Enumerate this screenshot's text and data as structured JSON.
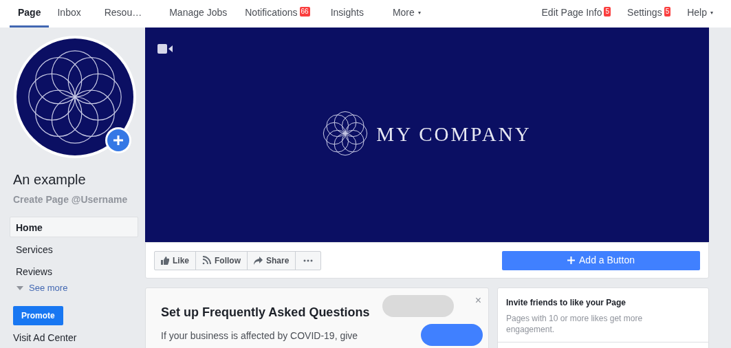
{
  "nav": {
    "tabs": [
      {
        "label": "Page",
        "selected": true
      },
      {
        "label": "Inbox",
        "selected": false
      },
      {
        "label": "Resou…",
        "selected": false
      },
      {
        "label": "Manage Jobs",
        "selected": false
      },
      {
        "label": "Notifications",
        "badge": "66",
        "selected": false
      },
      {
        "label": "Insights",
        "selected": false
      },
      {
        "label": "More",
        "caret": "▾",
        "selected": false
      }
    ],
    "right_tabs": [
      {
        "label": "Edit Page Info",
        "badge": "5"
      },
      {
        "label": "Settings",
        "badge": "5"
      },
      {
        "label": "Help",
        "caret": "▾"
      }
    ]
  },
  "sidebar": {
    "page_name": "An example",
    "username_link": "Create Page @Username",
    "items": [
      {
        "label": "Home",
        "selected": true
      },
      {
        "label": "Services",
        "selected": false
      },
      {
        "label": "Reviews",
        "selected": false
      }
    ],
    "see_more": "See more",
    "promote_button": "Promote",
    "ad_center_link": "Visit Ad Center"
  },
  "cover": {
    "logo_text": "MY COMPANY"
  },
  "actions": {
    "buttons": [
      {
        "kind": "like",
        "label": "Like"
      },
      {
        "kind": "follow",
        "label": "Follow"
      },
      {
        "kind": "share",
        "label": "Share"
      },
      {
        "kind": "more"
      }
    ],
    "add_button": "Add a Button"
  },
  "faq_card": {
    "close": "×",
    "title": "Set up Frequently Asked Questions",
    "body": "If your business is affected by COVID-19, give"
  },
  "invite_card": {
    "title": "Invite friends to like your Page",
    "body": "Pages with 10 or more likes get more engagement."
  }
}
